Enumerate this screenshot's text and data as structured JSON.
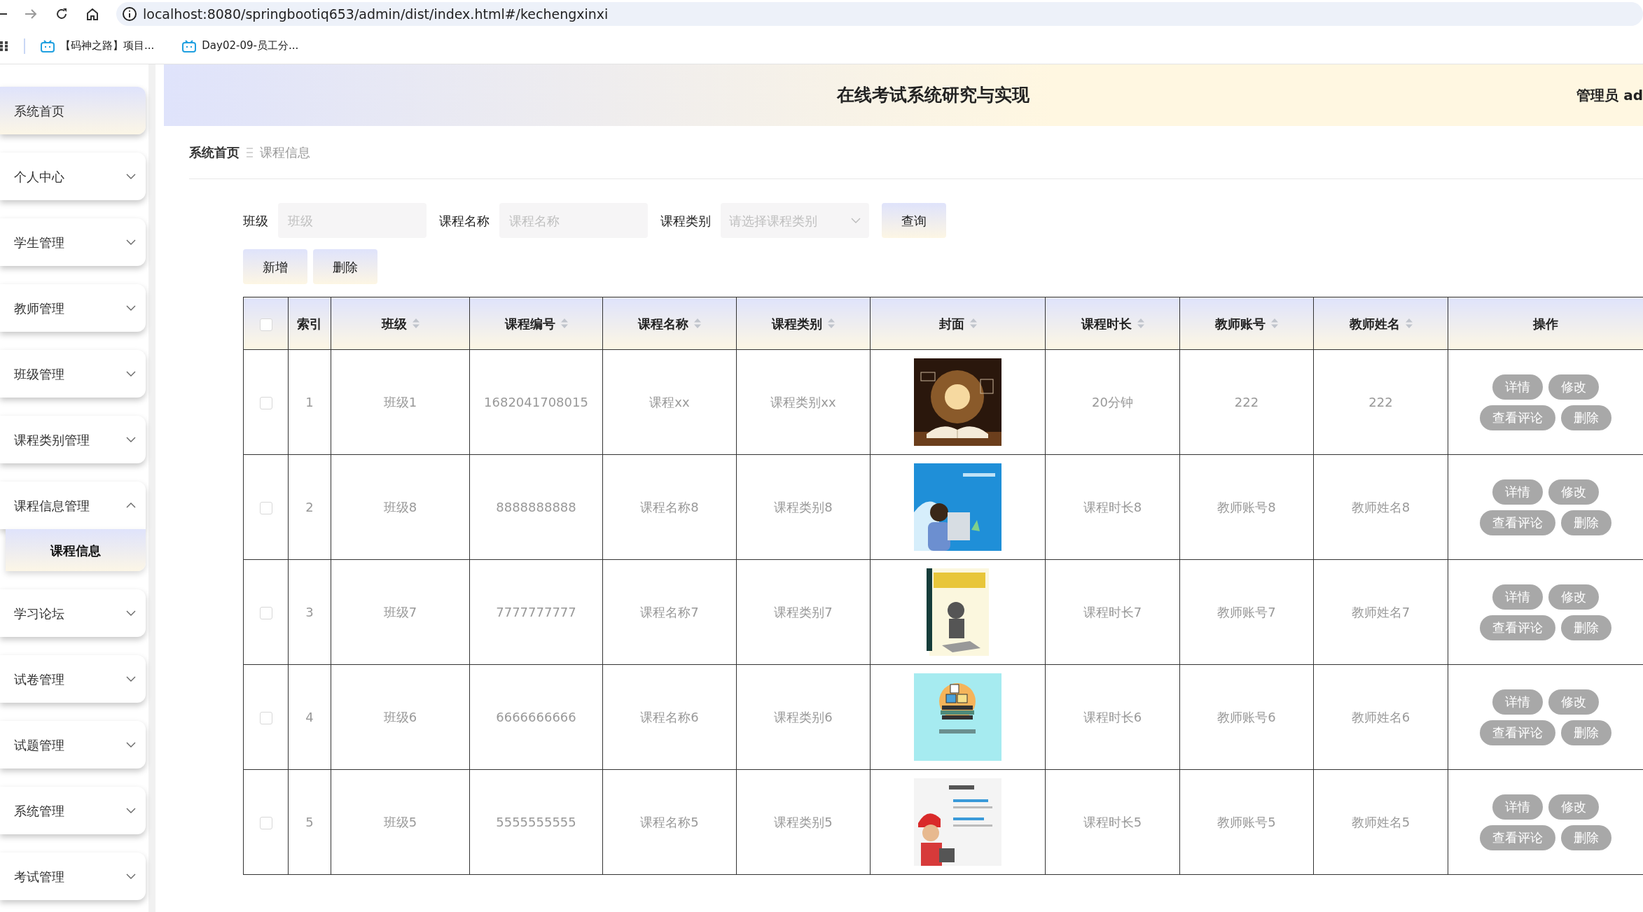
{
  "browser": {
    "url": "localhost:8080/springbootiq653/admin/dist/index.html#/kechengxinxi",
    "bookmarks": [
      {
        "label": "【码神之路】项目..."
      },
      {
        "label": "Day02-09-员工分..."
      }
    ]
  },
  "sidebar": {
    "items": [
      {
        "label": "系统首页",
        "selected": true
      },
      {
        "label": "个人中心",
        "selected": false,
        "expanded": false
      },
      {
        "label": "学生管理",
        "selected": false,
        "expanded": false
      },
      {
        "label": "教师管理",
        "selected": false,
        "expanded": false
      },
      {
        "label": "班级管理",
        "selected": false,
        "expanded": false
      },
      {
        "label": "课程类别管理",
        "selected": false,
        "expanded": false
      },
      {
        "label": "课程信息管理",
        "selected": false,
        "expanded": true,
        "children": [
          {
            "label": "课程信息",
            "selected": true
          }
        ]
      },
      {
        "label": "学习论坛",
        "selected": false,
        "expanded": false
      },
      {
        "label": "试卷管理",
        "selected": false,
        "expanded": false
      },
      {
        "label": "试题管理",
        "selected": false,
        "expanded": false
      },
      {
        "label": "系统管理",
        "selected": false,
        "expanded": false
      },
      {
        "label": "考试管理",
        "selected": false,
        "expanded": false
      }
    ]
  },
  "header": {
    "title": "在线考试系统研究与实现",
    "user": "管理员 ad"
  },
  "breadcrumb": [
    "系统首页",
    "课程信息"
  ],
  "search": {
    "fields": [
      {
        "label": "班级",
        "placeholder": "班级",
        "kind": "text"
      },
      {
        "label": "课程名称",
        "placeholder": "课程名称",
        "kind": "text"
      },
      {
        "label": "课程类别",
        "placeholder": "请选择课程类别",
        "kind": "select"
      }
    ],
    "button": "查询"
  },
  "actions": [
    "新增",
    "删除"
  ],
  "table": {
    "header_checked": false,
    "columns": [
      {
        "label": "索引",
        "sortable": false
      },
      {
        "label": "班级",
        "sortable": true
      },
      {
        "label": "课程编号",
        "sortable": true
      },
      {
        "label": "课程名称",
        "sortable": true
      },
      {
        "label": "课程类别",
        "sortable": true
      },
      {
        "label": "封面",
        "sortable": true
      },
      {
        "label": "课程时长",
        "sortable": true
      },
      {
        "label": "教师账号",
        "sortable": true
      },
      {
        "label": "教师姓名",
        "sortable": true
      },
      {
        "label": "操作",
        "sortable": false
      }
    ],
    "rows": [
      {
        "checked": false,
        "index": "1",
        "class": "班级1",
        "code": "1682041708015",
        "name": "课程xx",
        "category": "课程类别xx",
        "cover": {
          "kind": "picture"
        },
        "duration": "20分钟",
        "teacher_account": "222",
        "teacher_name": "222",
        "actions": [
          "详情",
          "修改",
          "查看评论",
          "删除"
        ]
      },
      {
        "checked": false,
        "index": "2",
        "class": "班级8",
        "code": "8888888888",
        "name": "课程名称8",
        "category": "课程类别8",
        "cover": {
          "kind": "picture"
        },
        "duration": "课程时长8",
        "teacher_account": "教师账号8",
        "teacher_name": "教师姓名8",
        "actions": [
          "详情",
          "修改",
          "查看评论",
          "删除"
        ]
      },
      {
        "checked": false,
        "index": "3",
        "class": "班级7",
        "code": "7777777777",
        "name": "课程名称7",
        "category": "课程类别7",
        "cover": {
          "kind": "picture"
        },
        "duration": "课程时长7",
        "teacher_account": "教师账号7",
        "teacher_name": "教师姓名7",
        "actions": [
          "详情",
          "修改",
          "查看评论",
          "删除"
        ]
      },
      {
        "checked": false,
        "index": "4",
        "class": "班级6",
        "code": "6666666666",
        "name": "课程名称6",
        "category": "课程类别6",
        "cover": {
          "kind": "picture"
        },
        "duration": "课程时长6",
        "teacher_account": "教师账号6",
        "teacher_name": "教师姓名6",
        "actions": [
          "详情",
          "修改",
          "查看评论",
          "删除"
        ]
      },
      {
        "checked": false,
        "index": "5",
        "class": "班级5",
        "code": "5555555555",
        "name": "课程名称5",
        "category": "课程类别5",
        "cover": {
          "kind": "picture"
        },
        "duration": "课程时长5",
        "teacher_account": "教师账号5",
        "teacher_name": "教师姓名5",
        "actions": [
          "详情",
          "修改",
          "查看评论",
          "删除"
        ]
      }
    ]
  }
}
